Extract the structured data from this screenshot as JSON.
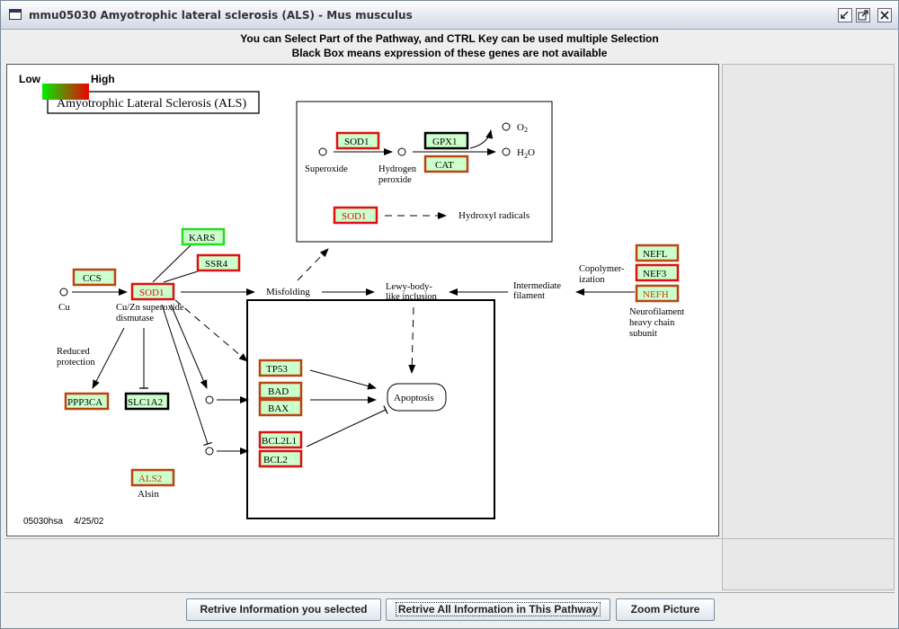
{
  "window": {
    "title": "mmu05030   Amyotrophic lateral sclerosis (ALS) - Mus musculus"
  },
  "instructions": {
    "line1": "You can Select Part of the Pathway, and CTRL Key can be used multiple Selection",
    "line2": "Black Box means expression of these genes are not available"
  },
  "legend": {
    "low_label": "Low",
    "high_label": "High",
    "gradient_from": "#00ee00",
    "gradient_to": "#ee0000"
  },
  "map": {
    "title": "Amyotrophic Lateral Sclerosis (ALS)",
    "footer_id": "05030hsa",
    "footer_date": "4/25/02",
    "genes": {
      "sod1_main": "SOD1",
      "sod1_box1": "SOD1",
      "sod1_box2": "SOD1",
      "ccs": "CCS",
      "kars": "KARS",
      "ssr4": "SSR4",
      "gpx1": "GPX1",
      "cat": "CAT",
      "nefl": "NEFL",
      "nef3": "NEF3",
      "nefh": "NEFH",
      "ppp3ca": "PPP3CA",
      "slc1a2": "SLC1A2",
      "tp53": "TP53",
      "bad": "BAD",
      "bax": "BAX",
      "bcl2l1": "BCL2L1",
      "bcl2": "BCL2",
      "als2": "ALS2"
    },
    "labels": {
      "superoxide": "Superoxide",
      "hydrogen": "Hydrogen",
      "peroxide": "peroxide",
      "o2": "O",
      "o2_sub": "2",
      "h2o_h": "H",
      "h2o_sub": "2",
      "h2o_o": "O",
      "hydroxyl": "Hydroxyl radicals",
      "cu": "Cu",
      "cuzn1": "Cu/Zn superoxide",
      "cuzn2": "dismutase",
      "misfolding": "Misfolding",
      "lewy1": "Lewy-body-",
      "lewy2": "like inclusion",
      "intermediate1": "Intermediate",
      "intermediate2": "filament",
      "copoly1": "Copolymer-",
      "copoly2": "ization",
      "nf1": "Neurofilament",
      "nf2": "heavy chain",
      "nf3": "subunit",
      "reduced1": "Reduced",
      "reduced2": "protection",
      "apoptosis": "Apoptosis",
      "alsin": "Alsin"
    }
  },
  "buttons": {
    "retrieve_selected": "Retrive Information you selected",
    "retrieve_all": "Retrive All Information in This Pathway",
    "zoom": "Zoom Picture"
  }
}
